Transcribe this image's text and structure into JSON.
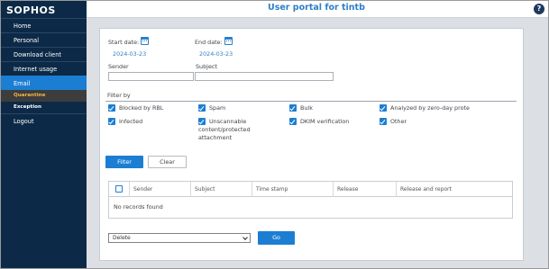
{
  "brand": {
    "logo": "SOPHOS"
  },
  "header": {
    "title": "User portal for tintb",
    "help_glyph": "?"
  },
  "nav": {
    "items": [
      {
        "label": "Home"
      },
      {
        "label": "Personal"
      },
      {
        "label": "Download client"
      },
      {
        "label": "Internet usage"
      },
      {
        "label": "Email",
        "active": true
      }
    ],
    "sub": [
      {
        "label": "Quarantine",
        "active": true
      },
      {
        "label": "Exception"
      }
    ],
    "logout": "Logout"
  },
  "form": {
    "start_label": "Start date:",
    "start_value": "2024-03-23",
    "end_label": "End date:",
    "end_value": "2024-03-23",
    "sender_label": "Sender",
    "sender_value": "",
    "subject_label": "Subject",
    "subject_value": "",
    "filter_by_label": "Filter by"
  },
  "filters": [
    {
      "label": "Blocked by RBL",
      "checked": true
    },
    {
      "label": "Spam",
      "checked": true
    },
    {
      "label": "Bulk",
      "checked": true
    },
    {
      "label": "Analyzed by zero-day prote",
      "checked": true
    },
    {
      "label": "Infected",
      "checked": true
    },
    {
      "label": "Unscannable content/protected attachment",
      "checked": true
    },
    {
      "label": "DKIM verification",
      "checked": true
    },
    {
      "label": "Other",
      "checked": true
    }
  ],
  "buttons": {
    "filter": "Filter",
    "clear": "Clear",
    "go": "Go"
  },
  "table": {
    "columns": [
      "Sender",
      "Subject",
      "Time stamp",
      "Release",
      "Release and report"
    ],
    "empty_text": "No records found"
  },
  "action": {
    "selected": "Delete"
  },
  "colors": {
    "accent": "#1c7ed3",
    "sidebar": "#0c2a47",
    "title": "#2d7fc8"
  }
}
